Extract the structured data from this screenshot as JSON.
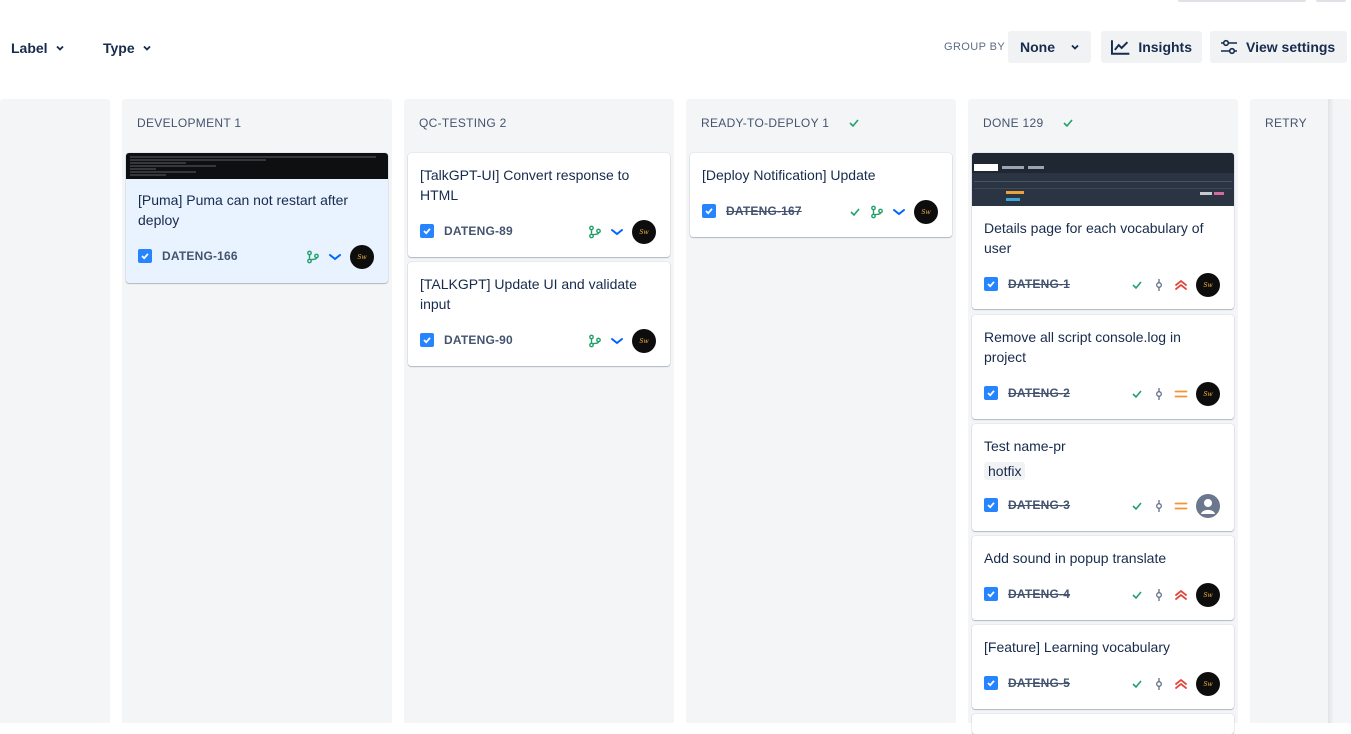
{
  "filters": {
    "label": "Label",
    "type": "Type"
  },
  "group_by": {
    "label": "GROUP BY",
    "value": "None"
  },
  "actions": {
    "insights": "Insights",
    "view_settings": "View settings"
  },
  "columns": [
    {
      "title": "DEVELOPMENT 1",
      "done": false,
      "cards": [
        {
          "title": "[Puma] Puma can not restart after deploy",
          "key": "DATENG-166",
          "done": false,
          "cover": "terminal",
          "selected": true,
          "icons": [
            "branch-icon",
            "priority-low-icon"
          ]
        }
      ]
    },
    {
      "title": "QC-TESTING 2",
      "done": false,
      "cards": [
        {
          "title": "[TalkGPT-UI] Convert response to HTML",
          "key": "DATENG-89",
          "done": false,
          "icons": [
            "branch-icon",
            "priority-low-icon"
          ]
        },
        {
          "title": "[TALKGPT] Update UI and validate input",
          "key": "DATENG-90",
          "done": false,
          "icons": [
            "branch-icon",
            "priority-low-icon"
          ]
        }
      ]
    },
    {
      "title": "READY-TO-DEPLOY 1",
      "done": true,
      "cards": [
        {
          "title": "[Deploy Notification] Update",
          "key": "DATENG-167",
          "done": true,
          "icons": [
            "done-check-icon",
            "branch-icon",
            "priority-low-icon"
          ]
        }
      ]
    },
    {
      "title": "DONE 129",
      "done": true,
      "cards": [
        {
          "title": "Details page for each vocabulary of user",
          "key": "DATENG-1",
          "done": true,
          "cover": "screenshot",
          "icons": [
            "done-check-icon",
            "commit-icon",
            "priority-highest-icon"
          ]
        },
        {
          "title": "Remove all script console.log in project",
          "key": "DATENG-2",
          "done": true,
          "icons": [
            "done-check-icon",
            "commit-icon",
            "priority-medium-icon"
          ]
        },
        {
          "title": "Test name-pr",
          "key": "DATENG-3",
          "done": true,
          "tag": "hotfix",
          "unassigned": true,
          "icons": [
            "done-check-icon",
            "commit-icon",
            "priority-medium-icon"
          ]
        },
        {
          "title": "Add sound in popup translate",
          "key": "DATENG-4",
          "done": true,
          "icons": [
            "done-check-icon",
            "commit-icon",
            "priority-highest-icon"
          ]
        },
        {
          "title": "[Feature] Learning vocabulary",
          "key": "DATENG-5",
          "done": true,
          "icons": [
            "done-check-icon",
            "commit-icon",
            "priority-highest-icon"
          ]
        }
      ]
    },
    {
      "title": "RETRY",
      "done": false,
      "cards": []
    }
  ],
  "colors": {
    "accent": "#2684ff",
    "success": "#22a06b",
    "priority_high": "#e2483d",
    "priority_medium": "#f79233",
    "priority_low": "#0065ff"
  }
}
